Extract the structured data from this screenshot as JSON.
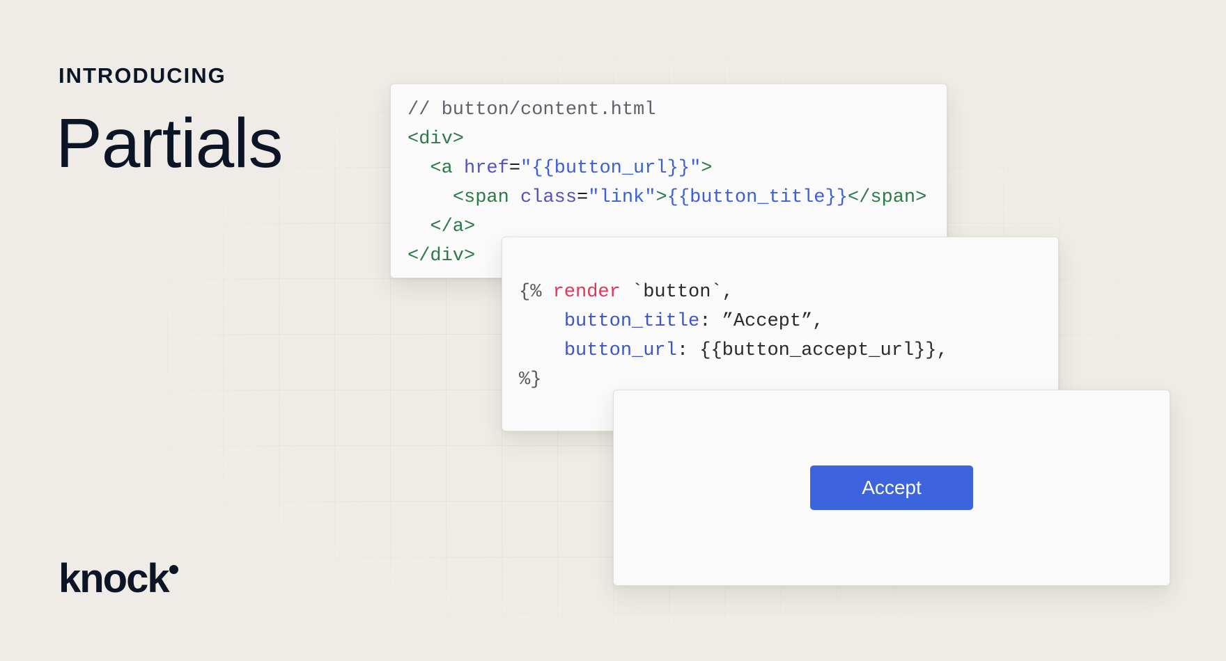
{
  "hero": {
    "eyebrow": "INTRODUCING",
    "headline": "Partials"
  },
  "brand": {
    "name": "knock"
  },
  "partial_source": {
    "comment": "// button/content.html",
    "lines": {
      "div_open": "<div>",
      "a_open_tag": "<a",
      "a_attr": "href",
      "a_eq": "=",
      "a_value": "\"{{button_url}}\"",
      "a_close_bracket": ">",
      "span_open_tag": "<span",
      "span_attr": "class",
      "span_eq": "=",
      "span_value": "\"link\"",
      "span_close_bracket": ">",
      "span_var": "{{button_title}}",
      "span_close_tag": "</span>",
      "a_close": "</a>",
      "div_close": "</div>"
    }
  },
  "render_call": {
    "open_delim": "{%",
    "keyword": "render",
    "partial_name": "`button`,",
    "arg1_key": "button_title",
    "arg1_rest": ": ”Accept”,",
    "arg2_key": "button_url",
    "arg2_rest": ": {{button_accept_url}},",
    "close_delim": "%}"
  },
  "preview": {
    "button_label": "Accept"
  },
  "colors": {
    "background": "#efece7",
    "ink": "#0b1525",
    "button": "#3d63dd",
    "code_tag": "#2c7a4a",
    "code_attr": "#5453b8",
    "code_string": "#3c5fd6",
    "code_keyword": "#e0365b"
  }
}
